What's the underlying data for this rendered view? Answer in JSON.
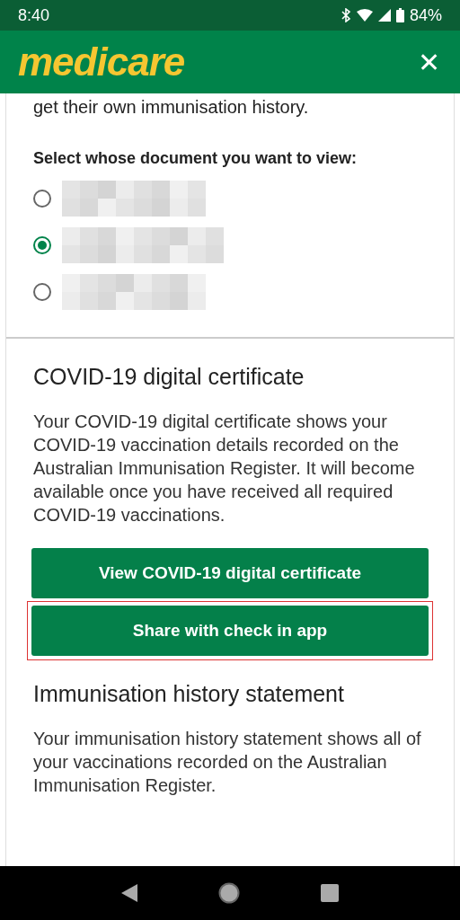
{
  "status_bar": {
    "time": "8:40",
    "battery": "84%"
  },
  "header": {
    "logo": "medicare",
    "close": "✕"
  },
  "intro": {
    "text": "get their own immunisation history."
  },
  "selector": {
    "label": "Select whose document you want to view:",
    "options": [
      {
        "selected": false
      },
      {
        "selected": true
      },
      {
        "selected": false
      }
    ]
  },
  "sections": [
    {
      "title": "COVID-19 digital certificate",
      "text": "Your COVID-19 digital certificate shows your COVID-19 vaccination details recorded on the Australian Immunisation Register. It will become available once you have received all required COVID-19 vaccinations.",
      "buttons": [
        {
          "label": "View COVID-19 digital certificate",
          "highlighted": false
        },
        {
          "label": "Share with check in app",
          "highlighted": true
        }
      ]
    },
    {
      "title": "Immunisation history statement",
      "text": "Your immunisation history statement shows all of your vaccinations recorded on the Australian Immunisation Register."
    }
  ]
}
